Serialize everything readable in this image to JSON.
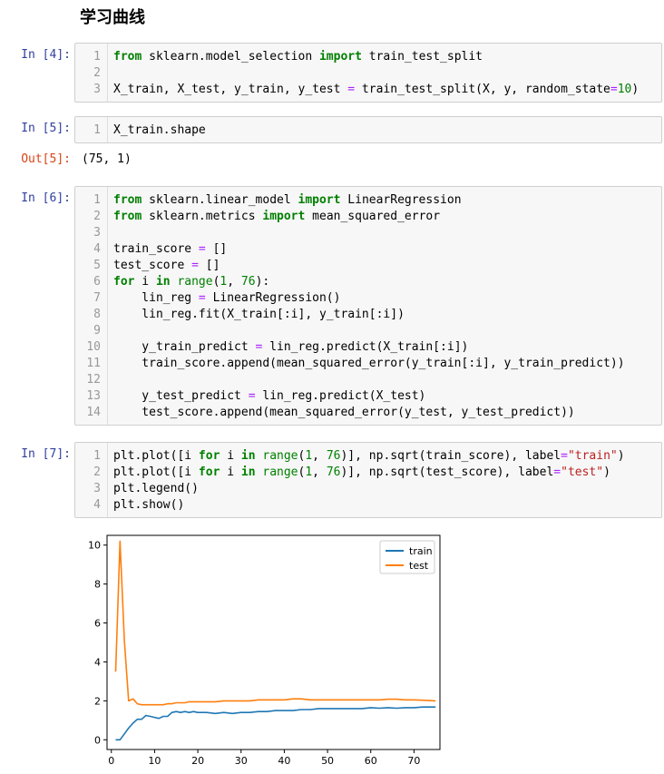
{
  "heading": "学习曲线",
  "cells": [
    {
      "prompt": "In  [4]:",
      "lines": [
        [
          [
            "kw",
            "from"
          ],
          [
            "t",
            " sklearn.model_selection "
          ],
          [
            "kw",
            "import"
          ],
          [
            "t",
            " train_test_split"
          ]
        ],
        [],
        [
          [
            "t",
            "X_train, X_test, y_train, y_test "
          ],
          [
            "op",
            "="
          ],
          [
            "t",
            " train_test_split(X, y, random_state"
          ],
          [
            "op",
            "="
          ],
          [
            "num",
            "10"
          ],
          [
            "t",
            ")"
          ]
        ]
      ]
    },
    {
      "prompt": "In  [5]:",
      "lines": [
        [
          [
            "t",
            "X_train.shape"
          ]
        ]
      ],
      "out_prompt": "Out[5]:",
      "output": "(75, 1)"
    },
    {
      "prompt": "In  [6]:",
      "lines": [
        [
          [
            "kw",
            "from"
          ],
          [
            "t",
            " sklearn.linear_model "
          ],
          [
            "kw",
            "import"
          ],
          [
            "t",
            " LinearRegression"
          ]
        ],
        [
          [
            "kw",
            "from"
          ],
          [
            "t",
            " sklearn.metrics "
          ],
          [
            "kw",
            "import"
          ],
          [
            "t",
            " mean_squared_error"
          ]
        ],
        [],
        [
          [
            "t",
            "train_score "
          ],
          [
            "op",
            "="
          ],
          [
            "t",
            " []"
          ]
        ],
        [
          [
            "t",
            "test_score "
          ],
          [
            "op",
            "="
          ],
          [
            "t",
            " []"
          ]
        ],
        [
          [
            "kw",
            "for"
          ],
          [
            "t",
            " i "
          ],
          [
            "kw",
            "in"
          ],
          [
            "t",
            " "
          ],
          [
            "num",
            "range"
          ],
          [
            "t",
            "("
          ],
          [
            "num",
            "1"
          ],
          [
            "t",
            ", "
          ],
          [
            "num",
            "76"
          ],
          [
            "t",
            "):"
          ]
        ],
        [
          [
            "t",
            "    lin_reg "
          ],
          [
            "op",
            "="
          ],
          [
            "t",
            " LinearRegression()"
          ]
        ],
        [
          [
            "t",
            "    lin_reg.fit(X_train[:i], y_train[:i])"
          ]
        ],
        [],
        [
          [
            "t",
            "    y_train_predict "
          ],
          [
            "op",
            "="
          ],
          [
            "t",
            " lin_reg.predict(X_train[:i])"
          ]
        ],
        [
          [
            "t",
            "    train_score.append(mean_squared_error(y_train[:i], y_train_predict))"
          ]
        ],
        [],
        [
          [
            "t",
            "    y_test_predict "
          ],
          [
            "op",
            "="
          ],
          [
            "t",
            " lin_reg.predict(X_test)"
          ]
        ],
        [
          [
            "t",
            "    test_score.append(mean_squared_error(y_test, y_test_predict))"
          ]
        ]
      ]
    },
    {
      "prompt": "In  [7]:",
      "lines": [
        [
          [
            "t",
            "plt.plot([i "
          ],
          [
            "kw",
            "for"
          ],
          [
            "t",
            " i "
          ],
          [
            "kw",
            "in"
          ],
          [
            "t",
            " "
          ],
          [
            "num",
            "range"
          ],
          [
            "t",
            "("
          ],
          [
            "num",
            "1"
          ],
          [
            "t",
            ", "
          ],
          [
            "num",
            "76"
          ],
          [
            "t",
            ")], np.sqrt(train_score), label"
          ],
          [
            "op",
            "="
          ],
          [
            "str",
            "\"train\""
          ],
          [
            "t",
            ")"
          ]
        ],
        [
          [
            "t",
            "plt.plot([i "
          ],
          [
            "kw",
            "for"
          ],
          [
            "t",
            " i "
          ],
          [
            "kw",
            "in"
          ],
          [
            "t",
            " "
          ],
          [
            "num",
            "range"
          ],
          [
            "t",
            "("
          ],
          [
            "num",
            "1"
          ],
          [
            "t",
            ", "
          ],
          [
            "num",
            "76"
          ],
          [
            "t",
            ")], np.sqrt(test_score), label"
          ],
          [
            "op",
            "="
          ],
          [
            "str",
            "\"test\""
          ],
          [
            "t",
            ")"
          ]
        ],
        [
          [
            "t",
            "plt.legend()"
          ]
        ],
        [
          [
            "t",
            "plt.show()"
          ]
        ]
      ]
    }
  ],
  "chart_data": {
    "type": "line",
    "xlim": [
      -1,
      76
    ],
    "ylim": [
      -0.5,
      10.5
    ],
    "xticks": [
      0,
      10,
      20,
      30,
      40,
      50,
      60,
      70
    ],
    "yticks": [
      0,
      2,
      4,
      6,
      8,
      10
    ],
    "grid": false,
    "legend_position": "top-right",
    "series": [
      {
        "name": "train",
        "color": "#1f77b4",
        "x": [
          1,
          2,
          3,
          4,
          5,
          6,
          7,
          8,
          9,
          10,
          11,
          12,
          13,
          14,
          15,
          16,
          17,
          18,
          19,
          20,
          22,
          24,
          26,
          28,
          30,
          32,
          34,
          36,
          38,
          40,
          42,
          44,
          46,
          48,
          50,
          52,
          54,
          56,
          58,
          60,
          62,
          64,
          66,
          68,
          70,
          72,
          75
        ],
        "y": [
          0.0,
          0.0,
          0.3,
          0.6,
          0.85,
          1.05,
          1.05,
          1.25,
          1.2,
          1.15,
          1.1,
          1.2,
          1.2,
          1.4,
          1.45,
          1.4,
          1.45,
          1.4,
          1.45,
          1.4,
          1.4,
          1.35,
          1.4,
          1.35,
          1.4,
          1.4,
          1.45,
          1.45,
          1.5,
          1.5,
          1.5,
          1.55,
          1.55,
          1.6,
          1.6,
          1.6,
          1.6,
          1.6,
          1.6,
          1.65,
          1.62,
          1.65,
          1.62,
          1.65,
          1.65,
          1.68,
          1.68
        ]
      },
      {
        "name": "test",
        "color": "#ff7f0e",
        "x": [
          1,
          2,
          3,
          4,
          5,
          6,
          7,
          8,
          9,
          10,
          11,
          12,
          13,
          14,
          15,
          16,
          17,
          18,
          19,
          20,
          22,
          24,
          26,
          28,
          30,
          32,
          34,
          36,
          38,
          40,
          42,
          44,
          46,
          48,
          50,
          52,
          54,
          56,
          58,
          60,
          62,
          64,
          66,
          68,
          70,
          72,
          75
        ],
        "y": [
          3.5,
          10.2,
          5.1,
          2.0,
          2.1,
          1.85,
          1.8,
          1.8,
          1.8,
          1.8,
          1.8,
          1.8,
          1.85,
          1.85,
          1.9,
          1.9,
          1.9,
          1.95,
          1.95,
          1.95,
          1.95,
          1.95,
          2.0,
          2.0,
          2.0,
          2.0,
          2.05,
          2.05,
          2.05,
          2.05,
          2.1,
          2.1,
          2.05,
          2.05,
          2.05,
          2.05,
          2.05,
          2.05,
          2.05,
          2.05,
          2.05,
          2.08,
          2.08,
          2.05,
          2.05,
          2.03,
          2.0
        ]
      }
    ]
  }
}
